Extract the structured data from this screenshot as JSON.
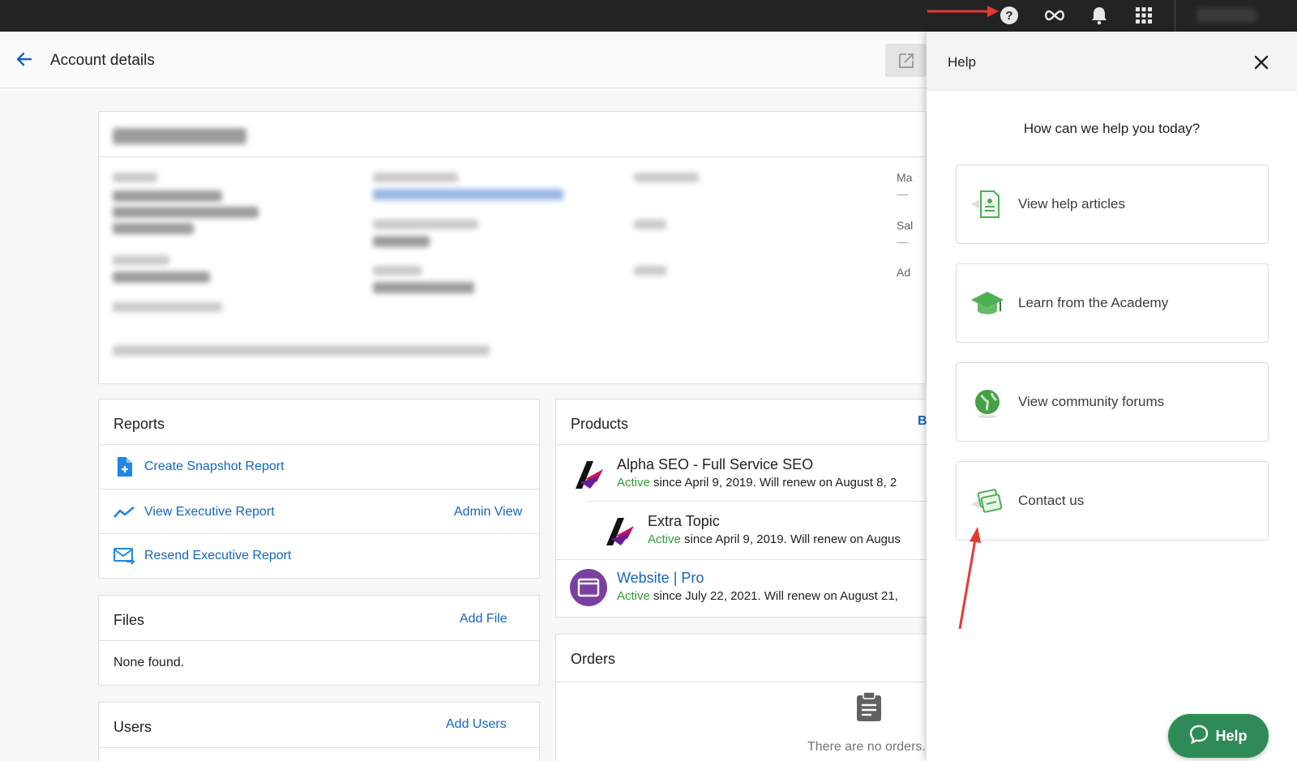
{
  "topbar": {
    "icons": [
      "help-circle-icon",
      "infinity-icon",
      "bell-icon",
      "apps-grid-icon"
    ]
  },
  "header": {
    "title": "Account details"
  },
  "reports": {
    "title": "Reports",
    "items": [
      {
        "label": "Create Snapshot Report",
        "icon": "add-document-icon"
      },
      {
        "label": "View Executive Report",
        "icon": "trend-line-icon",
        "action": "Admin View"
      },
      {
        "label": "Resend Executive Report",
        "icon": "mail-forward-icon"
      }
    ]
  },
  "files": {
    "title": "Files",
    "action": "Add File",
    "empty": "None found."
  },
  "users": {
    "title": "Users",
    "action": "Add Users"
  },
  "products": {
    "title": "Products",
    "partial_action": "Bi",
    "items": [
      {
        "name": "Alpha SEO - Full Service SEO",
        "status": "Active",
        "detail": " since April 9, 2019. Will renew on August 8, 2"
      },
      {
        "name": "Extra Topic",
        "status": "Active",
        "detail": " since April 9, 2019. Will renew on Augus"
      },
      {
        "name": "Website | Pro",
        "status": "Active",
        "detail": " since July 22, 2021. Will renew on August 21,"
      }
    ]
  },
  "orders": {
    "title": "Orders",
    "empty": "There are no orders."
  },
  "account_card": {
    "partial_labels": [
      "Ma",
      "Sal",
      "Ad"
    ],
    "dash": "—"
  },
  "help": {
    "title": "Help",
    "question": "How can we help you today?",
    "options": [
      {
        "label": "View help articles",
        "icon": "document-icon"
      },
      {
        "label": "Learn from the Academy",
        "icon": "graduation-cap-icon"
      },
      {
        "label": "View community forums",
        "icon": "globe-icon"
      },
      {
        "label": "Contact us",
        "icon": "chat-cards-icon"
      }
    ],
    "fab_label": "Help"
  },
  "colors": {
    "topbar": "#232323",
    "link": "#1565c0",
    "active": "#2e9d38",
    "help_fab": "#2e8b57",
    "annotation_arrow": "#e53935"
  }
}
